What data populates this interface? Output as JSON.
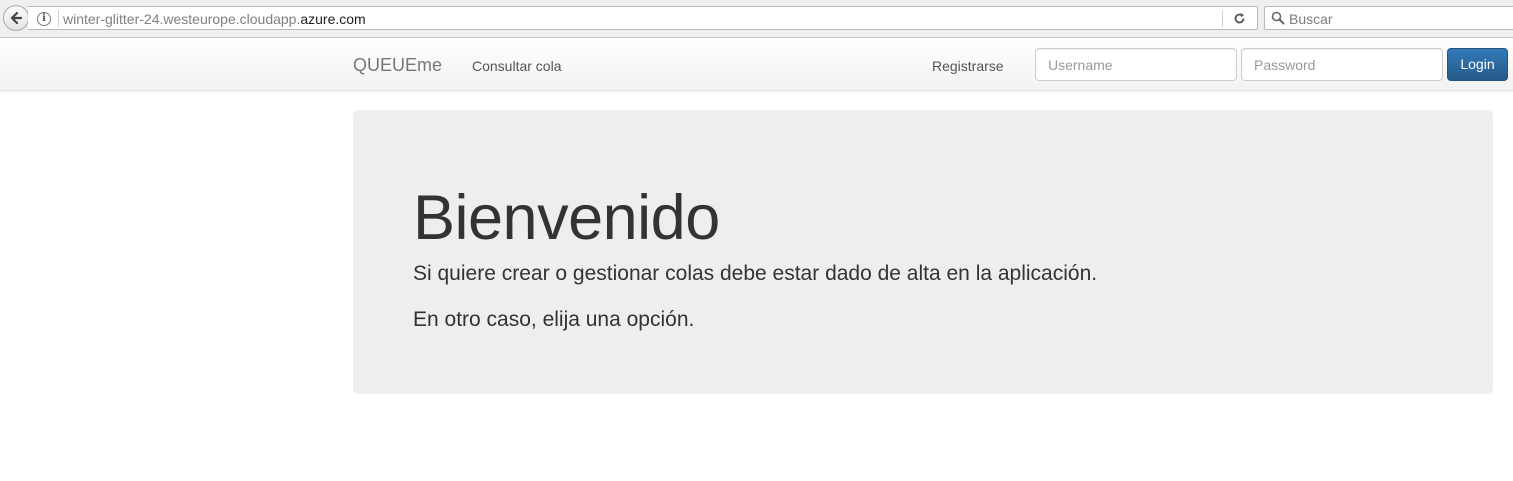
{
  "browser": {
    "url_prefix": "winter-glitter-24.westeurope.cloudapp.",
    "url_domain": "azure.com",
    "search_placeholder": "Buscar",
    "icons": [
      "back-arrow-icon",
      "info-icon",
      "reload-icon",
      "search-icon"
    ]
  },
  "navbar": {
    "brand": "QUEUEme",
    "links": {
      "consultar": "Consultar cola",
      "registrarse": "Registrarse"
    },
    "login_form": {
      "username_placeholder": "Username",
      "password_placeholder": "Password",
      "submit_label": "Login"
    }
  },
  "jumbotron": {
    "title": "Bienvenido",
    "paragraph1": "Si quiere crear o gestionar colas debe estar dado de alta en la aplicación.",
    "paragraph2": "En otro caso, elija una opción."
  },
  "colors": {
    "primary_button": "#337ab7",
    "jumbotron_bg": "#eeeeee",
    "text": "#333333"
  }
}
